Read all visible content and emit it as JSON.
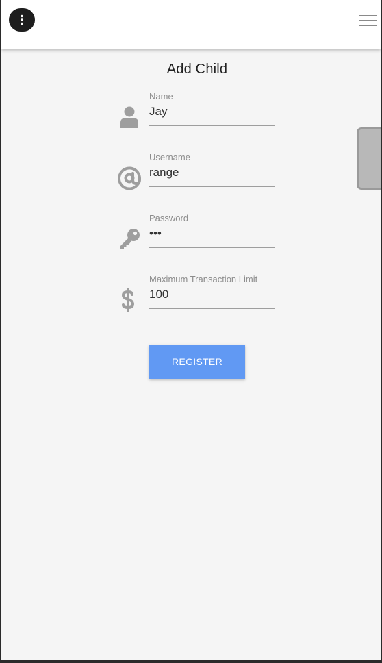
{
  "colors": {
    "accent": "#6199f3",
    "icon": "#9e9e9e",
    "background": "#f5f5f5",
    "appbar": "#ffffff"
  },
  "appbar": {
    "menu_icon": "more-vertical-icon",
    "nav_icon": "hamburger-menu-icon"
  },
  "page": {
    "title": "Add Child"
  },
  "form": {
    "name": {
      "label": "Name",
      "value": "Jay",
      "icon": "person-icon"
    },
    "username": {
      "label": "Username",
      "value": "range",
      "icon": "at-icon"
    },
    "password": {
      "label": "Password",
      "value": "•••",
      "icon": "key-icon"
    },
    "limit": {
      "label": "Maximum Transaction Limit",
      "value": "100",
      "icon": "dollar-icon"
    },
    "register_label": "REGISTER"
  }
}
